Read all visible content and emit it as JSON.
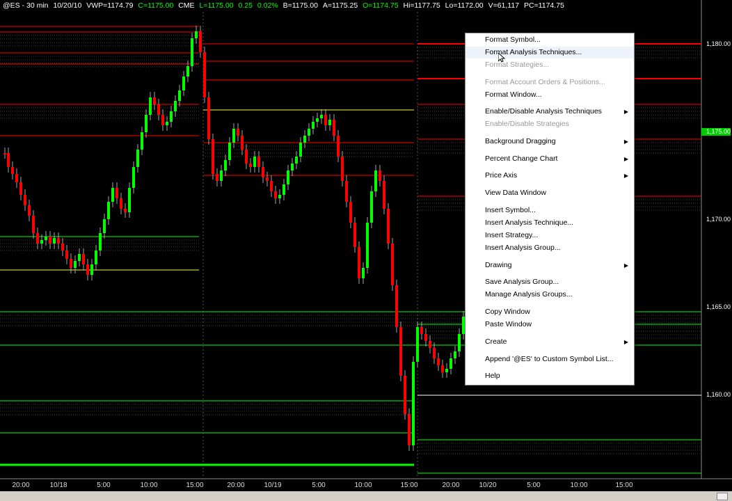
{
  "status_bar": {
    "symbol": "@ES - 30 min",
    "date": "10/20/10",
    "vwp": "VWP=1174.79",
    "close": "C=1175.00",
    "exchange": "CME",
    "last": "L=1175.00",
    "change": "0.25",
    "change_pct": "0.02%",
    "bid": "B=1175.00",
    "ask": "A=1175.25",
    "open": "O=1174.75",
    "high": "Hi=1177.75",
    "low": "Lo=1172.00",
    "volume": "V=61,117",
    "prev_close": "PC=1174.75"
  },
  "price_axis": {
    "labels": [
      "1,180.00",
      "1,175.00",
      "1,170.00",
      "1,165.00",
      "1,160.00"
    ],
    "values": [
      1180,
      1175,
      1170,
      1165,
      1160
    ],
    "current": "1,175.00",
    "current_value": 1175
  },
  "time_axis": {
    "labels": [
      "20:00",
      "10/18",
      "5:00",
      "10:00",
      "15:00",
      "20:00",
      "10/19",
      "5:00",
      "10:00",
      "15:00",
      "20:00",
      "10/20",
      "5:00",
      "10:00",
      "15:00"
    ]
  },
  "context_menu": {
    "items": [
      {
        "label": "Format Symbol...",
        "disabled": false,
        "submenu": false
      },
      {
        "label": "Format Analysis Techniques...",
        "disabled": false,
        "submenu": false,
        "hover": true
      },
      {
        "label": "Format Strategies...",
        "disabled": true,
        "submenu": false
      },
      {
        "label": "Format Account Orders & Positions...",
        "disabled": true,
        "submenu": false
      },
      {
        "label": "Format Window...",
        "disabled": false,
        "submenu": false
      },
      {
        "label": "Enable/Disable Analysis Techniques",
        "disabled": false,
        "submenu": true
      },
      {
        "label": "Enable/Disable Strategies",
        "disabled": true,
        "submenu": false
      },
      {
        "label": "Background Dragging",
        "disabled": false,
        "submenu": true
      },
      {
        "label": "Percent Change Chart",
        "disabled": false,
        "submenu": true
      },
      {
        "label": "Price Axis",
        "disabled": false,
        "submenu": true
      },
      {
        "label": "View Data Window",
        "disabled": false,
        "submenu": false
      },
      {
        "label": "Insert Symbol...",
        "disabled": false,
        "submenu": false
      },
      {
        "label": "Insert Analysis Technique...",
        "disabled": false,
        "submenu": false
      },
      {
        "label": "Insert Strategy...",
        "disabled": false,
        "submenu": false
      },
      {
        "label": "Insert Analysis Group...",
        "disabled": false,
        "submenu": false
      },
      {
        "label": "Drawing",
        "disabled": false,
        "submenu": true
      },
      {
        "label": "Save Analysis Group...",
        "disabled": false,
        "submenu": false
      },
      {
        "label": "Manage Analysis Groups...",
        "disabled": false,
        "submenu": false
      },
      {
        "label": "Copy Window",
        "disabled": false,
        "submenu": false
      },
      {
        "label": "Paste Window",
        "disabled": false,
        "submenu": false
      },
      {
        "label": "Create",
        "disabled": false,
        "submenu": true
      },
      {
        "label": "Append '@ES' to Custom Symbol List...",
        "disabled": false,
        "submenu": false
      },
      {
        "label": "Help",
        "disabled": false,
        "submenu": false
      }
    ]
  },
  "colors": {
    "up": "#00ff00",
    "down": "#ff0000",
    "background": "#000000",
    "level_red": "#ff0000",
    "level_green": "#00ff00",
    "level_yellow": "#ffff00"
  }
}
